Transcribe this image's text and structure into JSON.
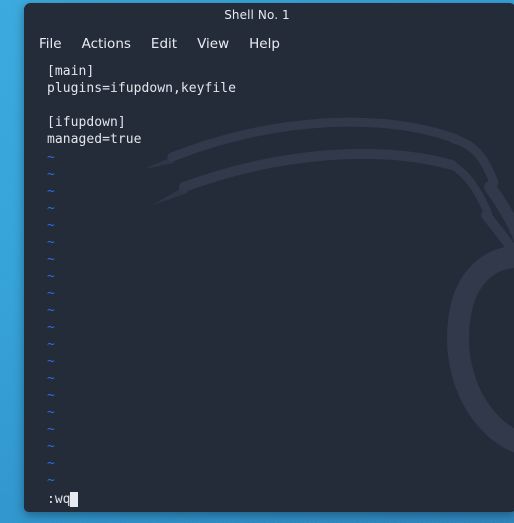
{
  "desktop": {
    "background_color": "#38a8dc"
  },
  "window": {
    "title": "Shell No. 1",
    "background_color": "#242b39",
    "menu": [
      {
        "label": "File"
      },
      {
        "label": "Actions"
      },
      {
        "label": "Edit"
      },
      {
        "label": "View"
      },
      {
        "label": "Help"
      }
    ]
  },
  "terminal": {
    "editor": "vim",
    "text_color": "#e3e6ec",
    "tilde_color": "#2a6fe8",
    "cursor_color": "#e8eaef",
    "buffer_lines": [
      "[main]",
      "plugins=ifupdown,keyfile",
      "",
      "[ifupdown]",
      "managed=true"
    ],
    "empty_line_marker": "~",
    "empty_line_count": 20,
    "command_line": ":wq",
    "cursor": "block"
  }
}
